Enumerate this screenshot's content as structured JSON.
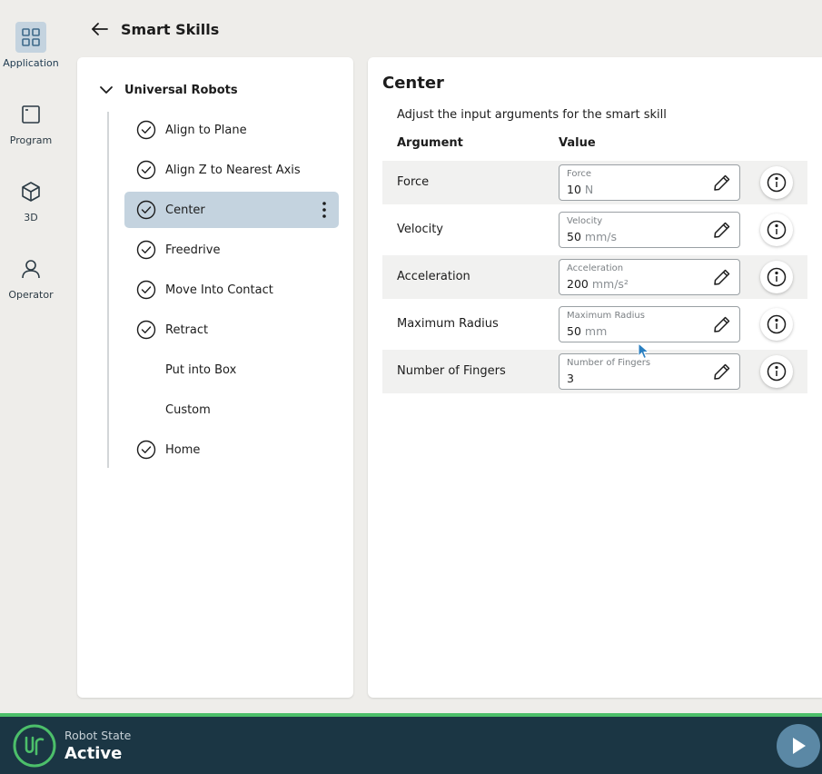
{
  "nav": {
    "items": [
      {
        "label": "Application",
        "icon": "grid-icon",
        "active": true
      },
      {
        "label": "Program",
        "icon": "program-window-icon",
        "active": false
      },
      {
        "label": "3D",
        "icon": "cube-icon",
        "active": false
      },
      {
        "label": "Operator",
        "icon": "person-icon",
        "active": false
      }
    ]
  },
  "header": {
    "title": "Smart Skills",
    "back_icon": "arrow-left-icon"
  },
  "tree": {
    "root_label": "Universal Robots",
    "items": [
      {
        "label": "Align to Plane",
        "checked": true
      },
      {
        "label": "Align Z to Nearest Axis",
        "checked": true
      },
      {
        "label": "Center",
        "checked": true,
        "selected": true
      },
      {
        "label": "Freedrive",
        "checked": true
      },
      {
        "label": "Move Into Contact",
        "checked": true
      },
      {
        "label": "Retract",
        "checked": true
      },
      {
        "label": "Put into Box",
        "checked": false
      },
      {
        "label": "Custom",
        "checked": false
      },
      {
        "label": "Home",
        "checked": true
      }
    ]
  },
  "detail": {
    "title": "Center",
    "subtitle": "Adjust the input arguments for the smart skill",
    "col_argument": "Argument",
    "col_value": "Value",
    "rows": [
      {
        "name": "Force",
        "field_label": "Force",
        "value": "10",
        "unit": "N"
      },
      {
        "name": "Velocity",
        "field_label": "Velocity",
        "value": "50",
        "unit": "mm/s"
      },
      {
        "name": "Acceleration",
        "field_label": "Acceleration",
        "value": "200",
        "unit": "mm/s²"
      },
      {
        "name": "Maximum Radius",
        "field_label": "Maximum Radius",
        "value": "50",
        "unit": "mm"
      },
      {
        "name": "Number of Fingers",
        "field_label": "Number of Fingers",
        "value": "3",
        "unit": ""
      }
    ]
  },
  "status": {
    "label": "Robot State",
    "value": "Active",
    "logo_text": "UR"
  },
  "colors": {
    "accent_green": "#4cbf6a",
    "bottom_bar": "#1b3644",
    "selected_bg": "#c4d3df",
    "play_button": "#5b88a5"
  }
}
